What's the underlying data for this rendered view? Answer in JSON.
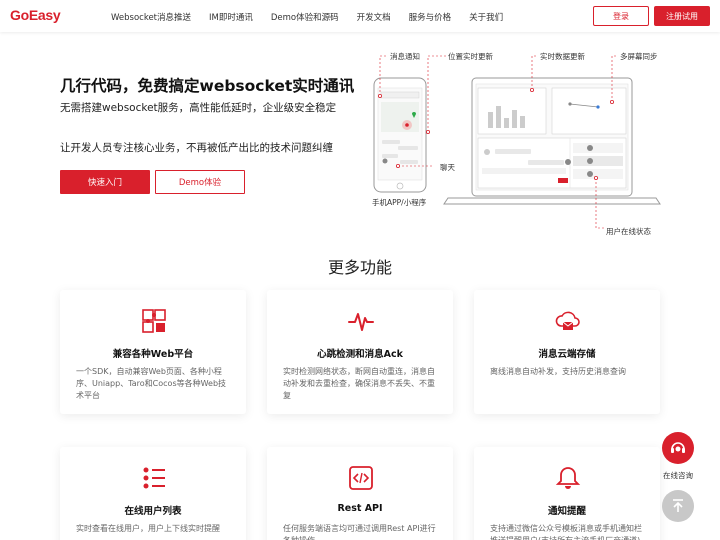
{
  "brand": {
    "logo": "GoEasy",
    "accent": "#d9202c"
  },
  "nav": {
    "items": [
      "Websocket消息推送",
      "IM即时通讯",
      "Demo体验和源码",
      "开发文档",
      "服务与价格",
      "关于我们"
    ],
    "login": "登录",
    "signup": "注册试用"
  },
  "hero": {
    "title": "几行代码，免费搞定websocket实时通讯",
    "subtitle": "无需搭建websocket服务，高性能低延时，企业级安全稳定",
    "description": "让开发人员专注核心业务，不再被低产出比的技术问题纠缠",
    "btn_start": "快速入门",
    "btn_demo": "Demo体验"
  },
  "illustration": {
    "labels": {
      "notify": "消息通知",
      "location": "位置实时更新",
      "realtime_data": "实时数据更新",
      "multiscreen": "多屏幕同步",
      "chat": "聊天",
      "mobile": "手机APP/小程序",
      "online_status": "用户在线状态"
    }
  },
  "features": {
    "title": "更多功能",
    "cards": [
      {
        "icon": "puzzle-icon",
        "title": "兼容各种Web平台",
        "desc": "一个SDK，自动兼容Web页面、各种小程序、Uniapp、Taro和Cocos等各种Web技术平台"
      },
      {
        "icon": "heartbeat-icon",
        "title": "心跳检测和消息Ack",
        "desc": "实时检测网络状态，断网自动重连，消息自动补发和去重检查，确保消息不丢失、不重复"
      },
      {
        "icon": "cloud-mail-icon",
        "title": "消息云端存储",
        "desc": "离线消息自动补发，支持历史消息查询"
      },
      {
        "icon": "user-list-icon",
        "title": "在线用户列表",
        "desc": "实时查看在线用户，用户上下线实时提醒"
      },
      {
        "icon": "code-icon",
        "title": "Rest API",
        "desc": "任何服务端语言均可通过调用Rest API进行各种操作"
      },
      {
        "icon": "bell-icon",
        "title": "通知提醒",
        "desc": "支持通过微信公众号模板消息或手机通知栏推送提醒用户(支持所有主流手机厂商通道)"
      }
    ]
  },
  "floating": {
    "support": "在线咨询"
  }
}
